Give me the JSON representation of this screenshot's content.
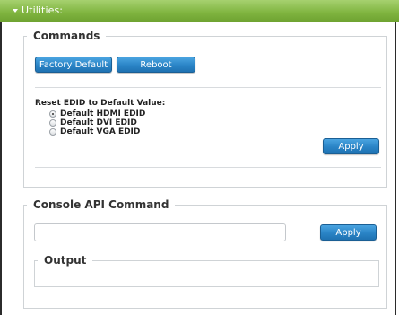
{
  "header": {
    "title": "Utilities:"
  },
  "commands": {
    "legend": "Commands",
    "factory_default_label": "Factory Default",
    "reboot_label": "Reboot",
    "reset_edid_label": "Reset EDID to Default Value:",
    "options": [
      {
        "label": "Default HDMI EDID",
        "selected": true
      },
      {
        "label": "Default DVI EDID",
        "selected": false
      },
      {
        "label": "Default VGA EDID",
        "selected": false
      }
    ],
    "apply_label": "Apply"
  },
  "console": {
    "legend": "Console API Command",
    "input_value": "",
    "input_placeholder": "",
    "apply_label": "Apply",
    "output_legend": "Output",
    "output_text": ""
  },
  "colors": {
    "header_green": "#7fb43f",
    "button_blue": "#2a84c6",
    "frame_border": "#2b2b2b"
  }
}
